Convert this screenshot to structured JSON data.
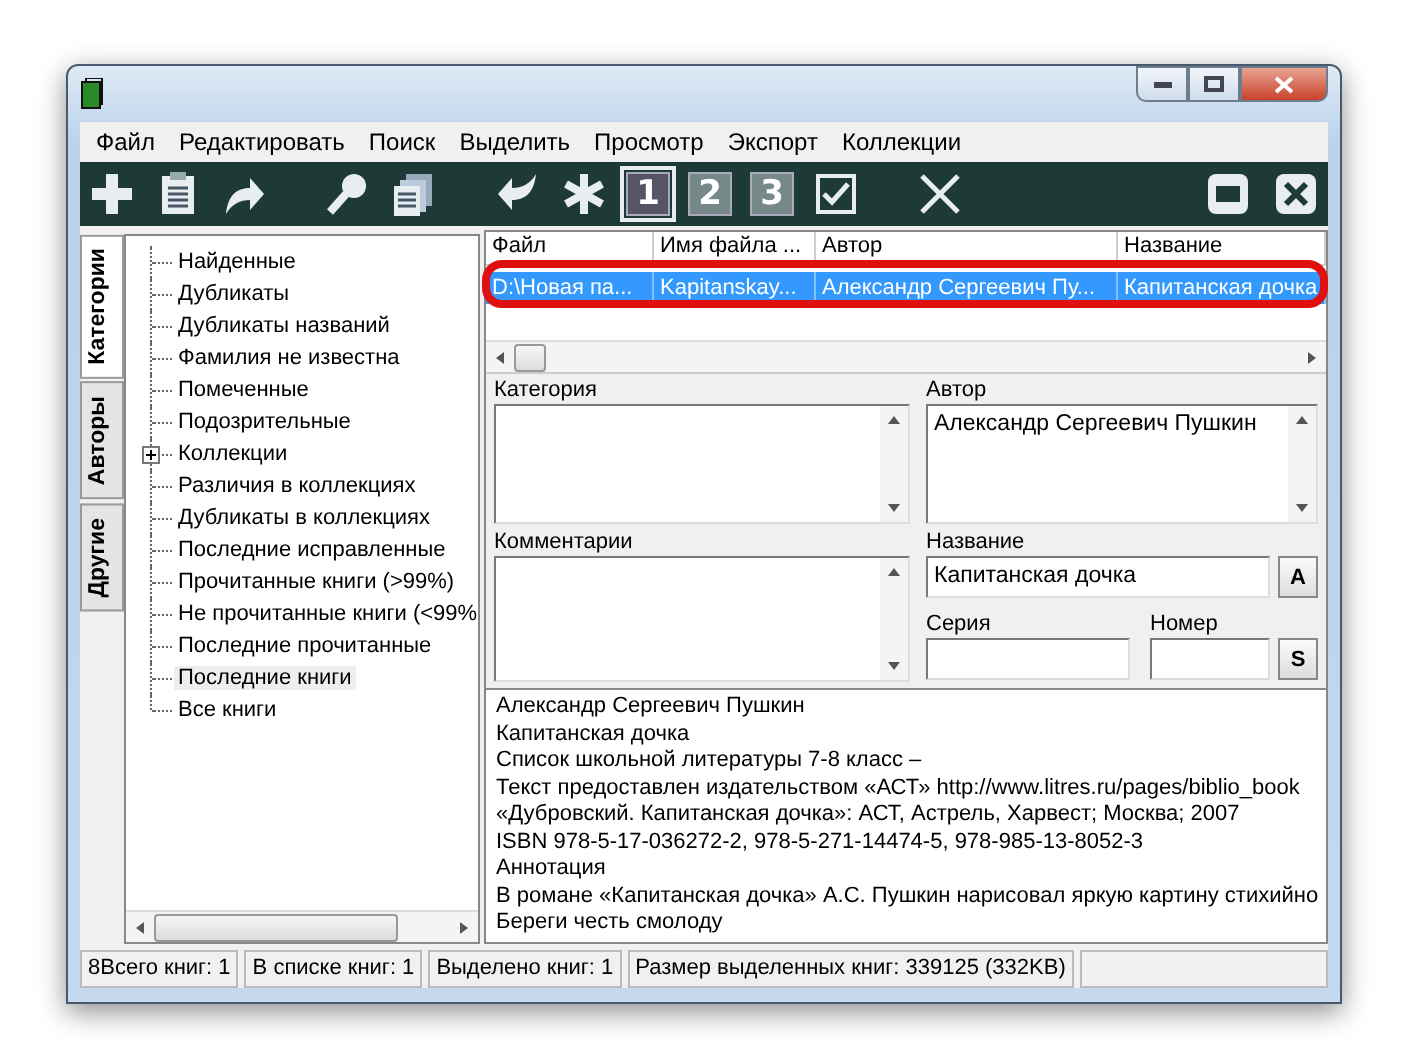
{
  "menu": [
    "Файл",
    "Редактировать",
    "Поиск",
    "Выделить",
    "Просмотр",
    "Экспорт",
    "Коллекции"
  ],
  "toolbar": [
    {
      "kind": "add"
    },
    {
      "kind": "document"
    },
    {
      "kind": "forward"
    },
    {
      "kind": "gap"
    },
    {
      "kind": "search"
    },
    {
      "kind": "pages"
    },
    {
      "kind": "gap"
    },
    {
      "kind": "back"
    },
    {
      "kind": "asterisk"
    },
    {
      "kind": "view",
      "label": "1",
      "selected": true
    },
    {
      "kind": "view",
      "label": "2",
      "selected": false
    },
    {
      "kind": "view",
      "label": "3",
      "selected": false
    },
    {
      "kind": "check"
    },
    {
      "kind": "gap"
    },
    {
      "kind": "delete"
    }
  ],
  "toolbar_right": [
    {
      "kind": "restore"
    },
    {
      "kind": "close"
    }
  ],
  "side_tabs": [
    {
      "label": "Категории",
      "selected": true
    },
    {
      "label": "Авторы",
      "selected": false
    },
    {
      "label": "Другие",
      "selected": false
    }
  ],
  "tree": [
    {
      "label": "Найденные",
      "selected": false
    },
    {
      "label": "Дубликаты",
      "selected": false
    },
    {
      "label": "Дубликаты названий",
      "selected": false
    },
    {
      "label": "Фамилия не известна",
      "selected": false
    },
    {
      "label": "Помеченные",
      "selected": false
    },
    {
      "label": "Подозрительные",
      "selected": false
    },
    {
      "label": "Коллекции",
      "selected": false,
      "expanded": false
    },
    {
      "label": "Различия в коллекциях",
      "selected": false
    },
    {
      "label": "Дубликаты в коллекциях",
      "selected": false
    },
    {
      "label": "Последние исправленные",
      "selected": false
    },
    {
      "label": "Прочитанные книги (>99%)",
      "selected": false
    },
    {
      "label": "Не прочитанные книги (<99%",
      "selected": false
    },
    {
      "label": "Последние прочитанные",
      "selected": false
    },
    {
      "label": "Последние книги",
      "selected": true
    },
    {
      "label": "Все книги",
      "selected": false
    }
  ],
  "grid": {
    "columns": [
      "Файл",
      "Имя файла ...",
      "Автор",
      "Название"
    ],
    "rows": [
      {
        "cells": [
          "D:\\Новая па...",
          "Kapitanskay...",
          "Александр Сергеевич Пу...",
          "Капитанская дочка"
        ],
        "selected": true
      }
    ]
  },
  "details": {
    "category": {
      "label": "Категория"
    },
    "author": {
      "label": "Автор",
      "value": "Александр Сергеевич Пушкин"
    },
    "comments": {
      "label": "Комментарии"
    },
    "title": {
      "label": "Название",
      "value": "Капитанская дочка",
      "button": "A"
    },
    "series": {
      "label": "Серия",
      "button": "S"
    },
    "number": {
      "label": "Номер"
    }
  },
  "annotation": [
    "Александр Сергеевич Пушкин",
    "Капитанская дочка",
    "Список школьной литературы 7-8 класс –",
    "Текст предоставлен издательством «АСТ» http://www.litres.ru/pages/biblio_book",
    "«Дубровский. Капитанская дочка»: АСТ, Астрель, Харвест; Москва; 2007",
    "ISBN 978-5-17-036272-2, 978-5-271-14474-5, 978-985-13-8052-3",
    "Аннотация",
    "В романе «Капитанская дочка» А.С. Пушкин нарисовал яркую картину стихийно",
    "Береги честь смолоду"
  ],
  "status_bar": [
    "8Всего книг: 1",
    "В списке книг: 1",
    "Выделено книг: 1",
    "Размер выделенных книг: 339125  (332KB)"
  ]
}
